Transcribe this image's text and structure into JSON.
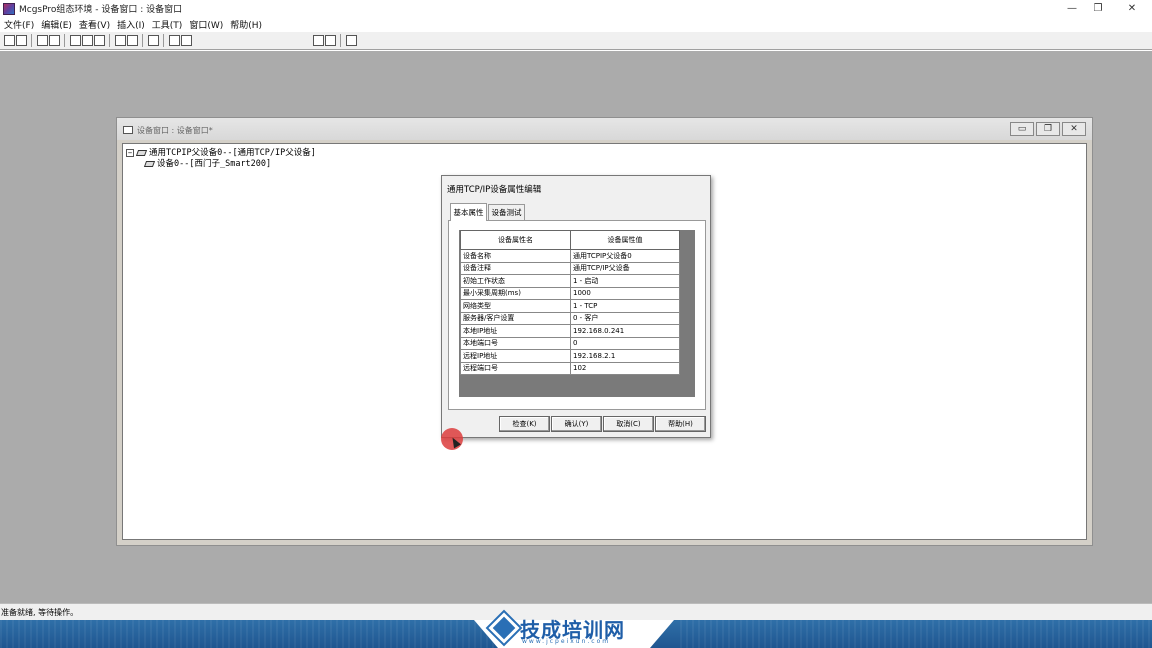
{
  "app": {
    "title": "McgsPro组态环境 - 设备窗口 : 设备窗口"
  },
  "window_controls": {
    "minimize": "—",
    "maximize": "❐",
    "close": "✕"
  },
  "menu": [
    "文件(F)",
    "编辑(E)",
    "查看(V)",
    "插入(I)",
    "工具(T)",
    "窗口(W)",
    "帮助(H)"
  ],
  "device_window": {
    "title": "设备窗口 : 设备窗口*",
    "tree": {
      "root": "通用TCPIP父设备0--[通用TCP/IP父设备]",
      "child": "设备0--[西门子_Smart200]",
      "root_toggle": "−"
    },
    "controls": {
      "minimize": "▭",
      "restore": "❐",
      "close": "✕"
    }
  },
  "dialog": {
    "title": "通用TCP/IP设备属性编辑",
    "tabs": [
      "基本属性",
      "设备测试"
    ],
    "columns": [
      "设备属性名",
      "设备属性值"
    ],
    "rows": [
      [
        "设备名称",
        "通用TCPIP父设备0"
      ],
      [
        "设备注释",
        "通用TCP/IP父设备"
      ],
      [
        "初始工作状态",
        "1 - 启动"
      ],
      [
        "最小采集周期(ms)",
        "1000"
      ],
      [
        "网络类型",
        "1 - TCP"
      ],
      [
        "服务器/客户设置",
        "0 - 客户"
      ],
      [
        "本地IP地址",
        "192.168.0.241"
      ],
      [
        "本地端口号",
        "0"
      ],
      [
        "远程IP地址",
        "192.168.2.1"
      ],
      [
        "远程端口号",
        "102"
      ]
    ],
    "buttons": [
      "检查(K)",
      "确认(Y)",
      "取消(C)",
      "帮助(H)"
    ]
  },
  "status": {
    "text": "准备就绪, 等待操作。"
  },
  "banner": {
    "name": "技成培训网",
    "url": "www.jcpeixun.com"
  },
  "colors": {
    "workspace": "#ababab",
    "banner": "#2a6fb5",
    "cursor": "#dc3c3c"
  }
}
